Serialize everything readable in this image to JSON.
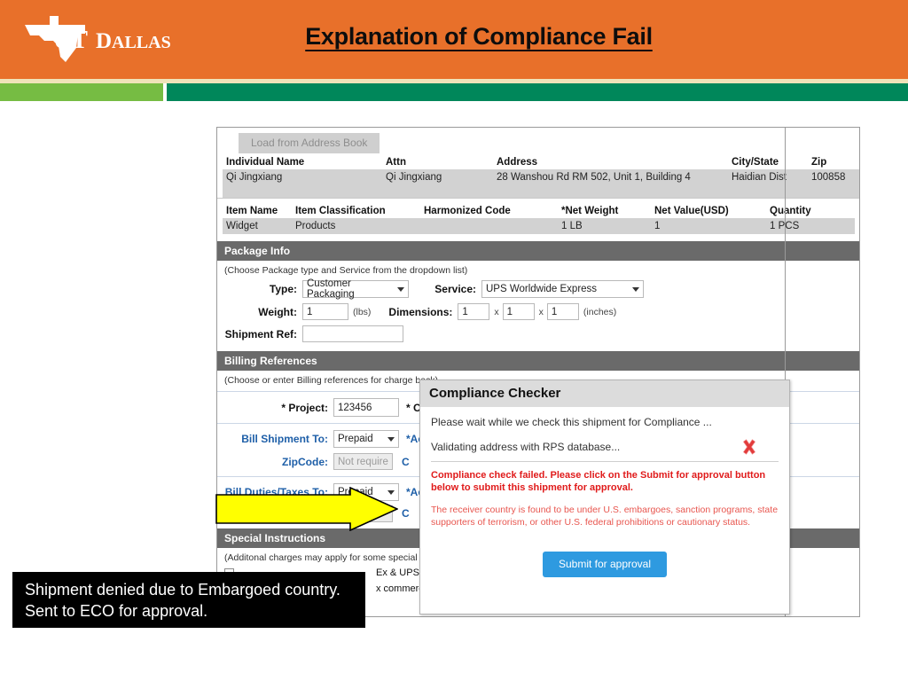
{
  "slide": {
    "title": "Explanation of Compliance Fail",
    "logo_text": "UT DALLAS",
    "colors": {
      "header_orange": "#e8702a",
      "stripe_cream": "#efe3b9",
      "stripe_green_left": "#76bc43",
      "stripe_green_right": "#00875a",
      "arrow_yellow": "#ffff00",
      "caption_bg": "#000000",
      "error_red": "#e01b1b",
      "submit_blue": "#2e9ae0",
      "section_bar_gray": "#6a6a6a"
    }
  },
  "form": {
    "address_book_button": "Load from Address Book",
    "recipient_headers": [
      "Individual Name",
      "Attn",
      "Address",
      "City/State",
      "Zip"
    ],
    "recipient_row": {
      "individual_name": "Qi Jingxiang",
      "attn": "Qi Jingxiang",
      "address": "28 Wanshou Rd RM 502, Unit 1, Building 4",
      "city_state": "Haidian Dist",
      "zip": "100858"
    },
    "item_headers": [
      "Item Name",
      "Item Classification",
      "Harmonized Code",
      "*Net Weight",
      "Net Value(USD)",
      "Quantity"
    ],
    "item_row": {
      "item_name": "Widget",
      "item_classification": "Products",
      "harmonized_code": "",
      "net_weight": "1   LB",
      "net_value": "1",
      "quantity": "1 PCS"
    },
    "package_info": {
      "section_title": "Package Info",
      "note": "(Choose Package type and Service from the dropdown list)",
      "type_label": "Type:",
      "type_value": "Customer Packaging",
      "service_label": "Service:",
      "service_value": "UPS Worldwide Express",
      "weight_label": "Weight:",
      "weight_value": "1",
      "weight_unit": "(lbs)",
      "dimensions_label": "Dimensions:",
      "dim_l": "1",
      "dim_w": "1",
      "dim_h": "1",
      "dim_sep": "x",
      "dim_unit": "(inches)",
      "shipment_ref_label": "Shipment Ref:",
      "shipment_ref_value": ""
    },
    "billing": {
      "section_title": "Billing References",
      "note": "(Choose or enter Billing references for charge back)",
      "project_label": "* Project:",
      "project_value": "123456",
      "cost_label": "* Cost",
      "bill_shipment_label": "Bill Shipment To:",
      "bill_shipment_value": "Prepaid",
      "account_label": "*Acc",
      "zipcode_label": "ZipCode:",
      "zipcode_placeholder": "Not require",
      "c_label": "C",
      "bill_duties_label": "Bill Duties/Taxes To:",
      "bill_duties_value": "Prepaid"
    },
    "special": {
      "section_title": "Special Instructions",
      "note": "(Additonal charges may apply for some special services)",
      "opt1": "Ex & UPS only)",
      "opt2": "x commercial d"
    }
  },
  "dialog": {
    "title": "Compliance Checker",
    "wait_text": "Please wait while we check this shipment for Compliance ...",
    "validating_text": "Validating address with RPS database...",
    "status_icon": "red-x-icon",
    "error_bold": "Compliance check failed. Please click on the Submit for approval button below to submit this shipment for approval.",
    "error_detail": "The receiver country is found to be under U.S. embargoes, sanction programs, state supporters of terrorism, or other U.S. federal prohibitions or cautionary status.",
    "submit_button": "Submit for approval"
  },
  "caption": {
    "text": "Shipment denied due to Embargoed country.  Sent to ECO for approval."
  }
}
